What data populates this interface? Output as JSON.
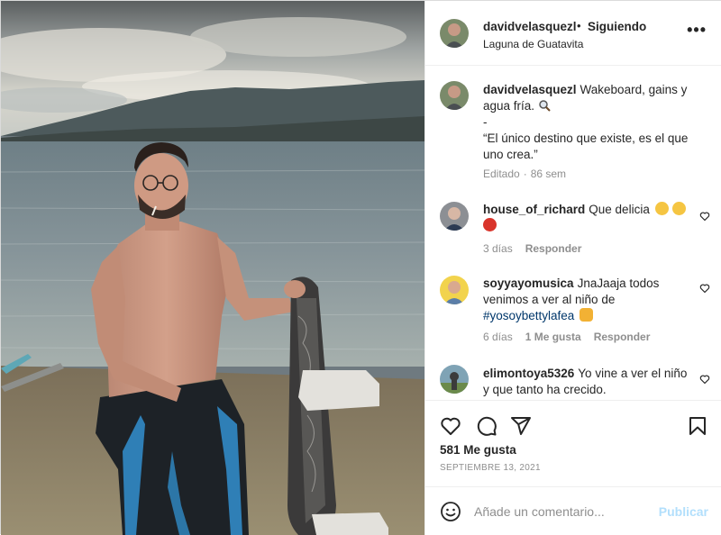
{
  "header": {
    "username": "davidvelasquezl",
    "separator": "•",
    "follow_status": "Siguiendo",
    "location": "Laguna de Guatavita",
    "more_icon": "more-horizontal-icon"
  },
  "caption": {
    "username": "davidvelasquezl",
    "line1": "Wakeboard, gains y agua fría.",
    "dash": "-",
    "quote": "“El único destino que existe, es el que uno crea.”",
    "edited": "Editado",
    "age": "86 sem"
  },
  "comments": [
    {
      "username": "house_of_richard",
      "text": "Que delicia",
      "age": "3 días",
      "reply": "Responder"
    },
    {
      "username": "soyyayomusica",
      "text": "JnaJaaja todos venimos a ver al niño de",
      "hashtag": "#yosoybettylafea",
      "age": "6 días",
      "likes": "1 Me gusta",
      "reply": "Responder"
    },
    {
      "username": "elimontoya5326",
      "text": "Yo vine a ver el niño y que tanto ha crecido."
    }
  ],
  "post": {
    "likes": "581 Me gusta",
    "date": "SEPTIEMBRE 13, 2021"
  },
  "add_comment": {
    "placeholder": "Añade un comentario...",
    "publish": "Publicar"
  },
  "colors": {
    "text": "#262626",
    "secondary": "#8e8e8e",
    "link": "#00376b",
    "publish_disabled": "#b2dffc",
    "border": "#efefef"
  }
}
